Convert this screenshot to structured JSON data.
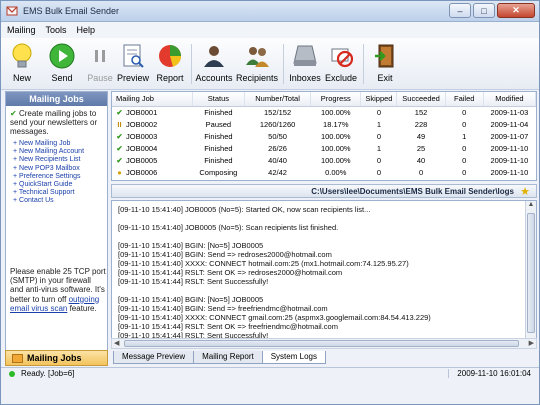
{
  "window": {
    "title": "EMS Bulk Email Sender",
    "minimize": "–",
    "maximize": "□",
    "close": "✕"
  },
  "menu": [
    "Mailing",
    "Tools",
    "Help"
  ],
  "toolbar": {
    "new": "New",
    "send": "Send",
    "pause": "Pause",
    "preview": "Preview",
    "report": "Report",
    "accounts": "Accounts",
    "recipients": "Recipients",
    "inboxes": "Inboxes",
    "exclude": "Exclude",
    "exit": "Exit"
  },
  "sidebar": {
    "header": "Mailing Jobs",
    "intro": "Create mailing jobs to send your newsletters or messages.",
    "links": [
      "+ New Mailing Job",
      "+ New Mailing Account",
      "+ New Recipients List",
      "+ New POP3 Mailbox",
      "+ Preference Settings",
      "+ QuickStart Guide",
      "+ Technical Support",
      "+ Contact Us"
    ],
    "note_text": "Please enable 25 TCP port (SMTP) in your firewall and anti-virus software. It's better to turn off ",
    "note_link": "outgoing email virus scan",
    "note_end": " feature.",
    "tab": "Mailing Jobs"
  },
  "jobs": {
    "columns": [
      "Mailing Job",
      "Status",
      "Number/Total",
      "Progress",
      "Skipped",
      "Succeeded",
      "Failed",
      "Modified"
    ],
    "rows": [
      {
        "icon": "check-icon",
        "job": "JOB0001",
        "status": "Finished",
        "number": "152/152",
        "progress": "100.00%",
        "skipped": "0",
        "succeeded": "152",
        "failed": "0",
        "modified": "2009-11-03"
      },
      {
        "icon": "pause-icon",
        "job": "JOB0002",
        "status": "Paused",
        "number": "1260/1260",
        "progress": "18.17%",
        "skipped": "1",
        "succeeded": "228",
        "failed": "0",
        "modified": "2009-11-04"
      },
      {
        "icon": "check-icon",
        "job": "JOB0003",
        "status": "Finished",
        "number": "50/50",
        "progress": "100.00%",
        "skipped": "0",
        "succeeded": "49",
        "failed": "1",
        "modified": "2009-11-07"
      },
      {
        "icon": "check-icon",
        "job": "JOB0004",
        "status": "Finished",
        "number": "26/26",
        "progress": "100.00%",
        "skipped": "1",
        "succeeded": "25",
        "failed": "0",
        "modified": "2009-11-10"
      },
      {
        "icon": "check-icon",
        "job": "JOB0005",
        "status": "Finished",
        "number": "40/40",
        "progress": "100.00%",
        "skipped": "0",
        "succeeded": "40",
        "failed": "0",
        "modified": "2009-11-10"
      },
      {
        "icon": "composing-icon",
        "job": "JOB0006",
        "status": "Composing",
        "number": "42/42",
        "progress": "0.00%",
        "skipped": "0",
        "succeeded": "0",
        "failed": "0",
        "modified": "2009-11-10"
      }
    ]
  },
  "logpath": "C:\\Users\\lee\\Documents\\EMS Bulk Email Sender\\logs",
  "log": [
    "[09-11-10 15:41:40] JOB0005 (No=5): Started OK, now scan recipients list...",
    "",
    "[09-11-10 15:41:40] JOB0005 (No=5): Scan recipients list finished.",
    "",
    "[09-11-10 15:41:40] BGIN: [No=5] JOB0005",
    "[09-11-10 15:41:40] BGIN: Send => redroses2000@hotmail.com",
    "[09-11-10 15:41:40] XXXX: CONNECT hotmail.com:25 (mx1.hotmail.com:74.125.95.27)",
    "[09-11-10 15:41:44] RSLT: Sent OK => redroses2000@hotmail.com",
    "[09-11-10 15:41:44] RSLT: Sent Successfully!",
    "",
    "[09-11-10 15:41:40] BGIN: [No=5] JOB0005",
    "[09-11-10 15:41:40] BGIN: Send => freefriendmc@hotmail.com",
    "[09-11-10 15:41:40] XXXX: CONNECT gmail.com:25 (aspmx3.googlemail.com:84.54.413.229)",
    "[09-11-10 15:41:44] RSLT: Sent OK => freefriendmc@hotmail.com",
    "[09-11-10 15:41:44] RSLT: Sent Successfully!"
  ],
  "tabs": [
    "Message Preview",
    "Mailing Report",
    "System Logs"
  ],
  "status": {
    "text": "Ready. [Job=6]",
    "time": "2009-11-10 16:01:04"
  }
}
